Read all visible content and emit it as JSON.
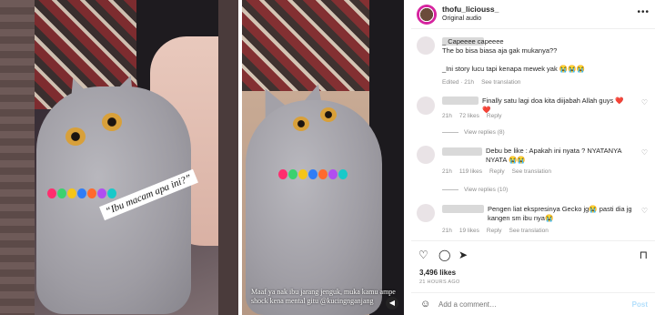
{
  "post": {
    "username": "thofu_liciouss_",
    "audio": "Original audio",
    "caption_left": "“Ibu macam apa ini?”",
    "caption_right": "Maaf ya nak ibu jarang jenguk, muka kamu ampe shock kena mental gitu @kucingnganjang"
  },
  "comments": [
    {
      "text": "_ Capeeee capeeee\nThe bo bisa biasa aja gak mukanya??\n\n_Ini story lucu tapi kenapa mewek yak 😭😭😭",
      "time": "Edited · 21h",
      "see_translation": "See translation"
    },
    {
      "text": "Finally satu lagi doa kita diijabah Allah guys ❤️❤️",
      "time": "21h",
      "likes": "72 likes",
      "reply": "Reply",
      "view_replies": "View replies (8)"
    },
    {
      "text": "Debu be like : Apakah ini nyata ? NYATANYA NYATA 😭😭",
      "time": "21h",
      "likes": "119 likes",
      "reply": "Reply",
      "see_translation": "See translation",
      "view_replies": "View replies (10)"
    },
    {
      "text": "Pengen liat ekspresinya Gecko jg😭 pasti dia jg kangen sm ibu nya😭",
      "time": "21h",
      "likes": "19 likes",
      "reply": "Reply",
      "see_translation": "See translation"
    }
  ],
  "footer": {
    "likes": "3,496 likes",
    "time_ago": "21 HOURS AGO",
    "add_comment_placeholder": "Add a comment…",
    "post_label": "Post"
  },
  "colors": {
    "accent_link": "#b2dffc",
    "meta_grey": "#8e8e8e",
    "text": "#262626"
  },
  "icons": [
    "heart-icon",
    "comment-icon",
    "share-icon",
    "bookmark-icon",
    "emoji-icon",
    "more-icon",
    "mute-icon"
  ]
}
